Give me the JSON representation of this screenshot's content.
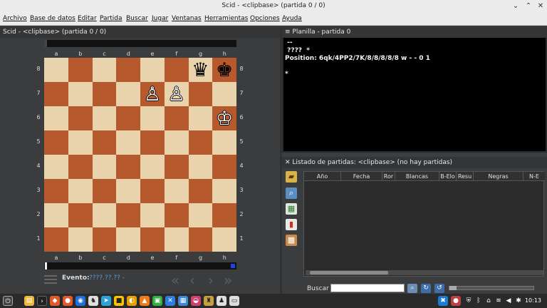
{
  "window": {
    "title": "Scid - <clipbase> (partida 0 / 0)",
    "minimize_glyph": "⌄",
    "maximize_glyph": "⌃",
    "close_glyph": "✕"
  },
  "menu": [
    "Archivo",
    "Base de datos",
    "Editar",
    "Partida",
    "Buscar",
    "Jugar",
    "Ventanas",
    "Herramientas",
    "Opciones",
    "Ayuda"
  ],
  "board_panel": {
    "title": "Scid - <clipbase> (partida 0 / 0)",
    "files": [
      "a",
      "b",
      "c",
      "d",
      "e",
      "f",
      "g",
      "h"
    ],
    "ranks": [
      "8",
      "7",
      "6",
      "5",
      "4",
      "3",
      "2",
      "1"
    ],
    "pieces": {
      "g8": "♛",
      "h8": "♚",
      "e7": "♙",
      "f7": "♙",
      "h6": "♔"
    },
    "piece_colors": {
      "g8": "black",
      "h8": "black",
      "e7": "white",
      "f7": "white",
      "h6": "white"
    },
    "light_square_color": "#e9d3ad",
    "dark_square_color": "#b6592c",
    "event_label": "Evento:",
    "event_value": "????.??.?? -",
    "nav_icons": [
      "first-move-icon",
      "prev-move-icon",
      "next-move-icon",
      "last-move-icon"
    ],
    "nav_glyphs": [
      "«",
      "‹",
      "›",
      "»"
    ]
  },
  "planilla": {
    "title": "Planilla - partida 0",
    "close_glyph": "≡",
    "lines": [
      " --",
      " ????  *",
      "Position: 6qk/4PP2/7K/8/8/8/8/8 w - - 0 1",
      "",
      "*"
    ]
  },
  "listado": {
    "title": "Listado de partidas: <clipbase> (no hay partidas)",
    "close_glyph": "✕",
    "columns": [
      "Año",
      "Fecha",
      "Ror",
      "Blancas",
      "B-Elo",
      "Resu",
      "Negras",
      "N-E"
    ],
    "search_label": "Buscar",
    "search_value": "",
    "tool_icons": [
      "eraser-icon",
      "zoom-icon",
      "table-icon",
      "stats-icon",
      "board-icon"
    ]
  },
  "taskbar": {
    "clock": "10:13"
  }
}
